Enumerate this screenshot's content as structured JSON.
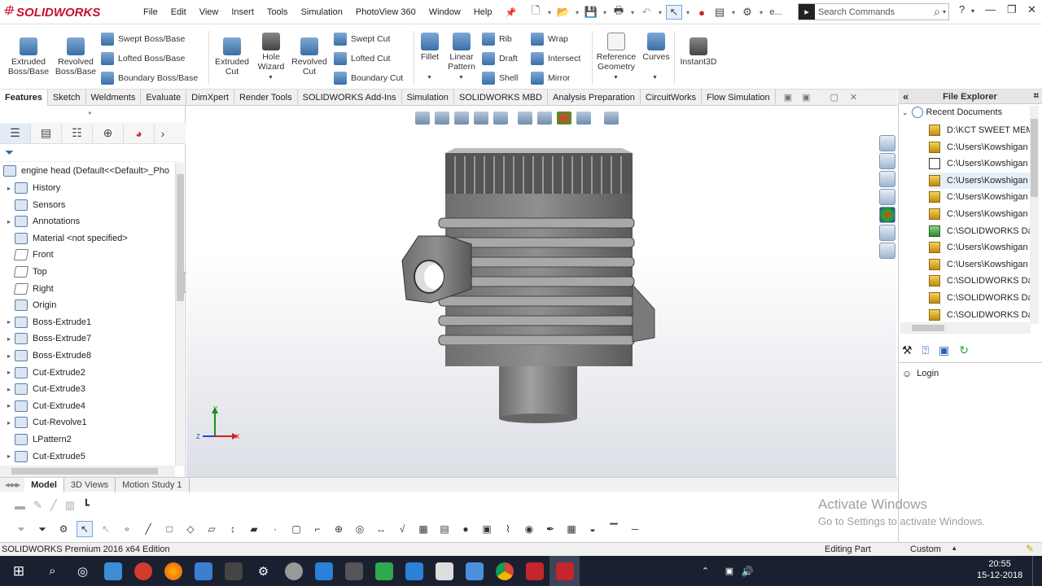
{
  "app": {
    "brand": "SOLIDWORKS",
    "menu": [
      "File",
      "Edit",
      "View",
      "Insert",
      "Tools",
      "Simulation",
      "PhotoView 360",
      "Window",
      "Help"
    ],
    "quick_access_truncated": "e...",
    "search_placeholder": "Search Commands",
    "help_glyph": "?"
  },
  "command_manager": {
    "big_tools": [
      {
        "label": "Extruded\nBoss/Base"
      },
      {
        "label": "Revolved\nBoss/Base"
      },
      {
        "label": "Extruded\nCut"
      },
      {
        "label": "Hole\nWizard"
      },
      {
        "label": "Revolved\nCut"
      },
      {
        "label": "Fillet"
      },
      {
        "label": "Linear\nPattern"
      },
      {
        "label": "Reference\nGeometry"
      },
      {
        "label": "Curves"
      },
      {
        "label": "Instant3D"
      }
    ],
    "small_tools": {
      "boss": [
        "Swept Boss/Base",
        "Lofted Boss/Base",
        "Boundary Boss/Base"
      ],
      "cut": [
        "Swept Cut",
        "Lofted Cut",
        "Boundary Cut"
      ],
      "features1": [
        "Rib",
        "Draft",
        "Shell"
      ],
      "features2": [
        "Wrap",
        "Intersect",
        "Mirror"
      ]
    }
  },
  "tabs": [
    "Features",
    "Sketch",
    "Weldments",
    "Evaluate",
    "DimXpert",
    "Render Tools",
    "SOLIDWORKS Add-Ins",
    "Simulation",
    "SOLIDWORKS MBD",
    "Analysis Preparation",
    "CircuitWorks",
    "Flow Simulation"
  ],
  "active_tab": "Features",
  "feature_tree": {
    "root": "engine head  (Default<<Default>_Pho",
    "items": [
      {
        "label": "History",
        "expandable": true
      },
      {
        "label": "Sensors",
        "expandable": false
      },
      {
        "label": "Annotations",
        "expandable": true
      },
      {
        "label": "Material <not specified>",
        "expandable": false
      },
      {
        "label": "Front",
        "expandable": false
      },
      {
        "label": "Top",
        "expandable": false
      },
      {
        "label": "Right",
        "expandable": false
      },
      {
        "label": "Origin",
        "expandable": false
      },
      {
        "label": "Boss-Extrude1",
        "expandable": true
      },
      {
        "label": "Boss-Extrude7",
        "expandable": true
      },
      {
        "label": "Boss-Extrude8",
        "expandable": true
      },
      {
        "label": "Cut-Extrude2",
        "expandable": true
      },
      {
        "label": "Cut-Extrude3",
        "expandable": true
      },
      {
        "label": "Cut-Extrude4",
        "expandable": true
      },
      {
        "label": "Cut-Revolve1",
        "expandable": true
      },
      {
        "label": "LPattern2",
        "expandable": false
      },
      {
        "label": "Cut-Extrude5",
        "expandable": true
      }
    ]
  },
  "bottom_tabs": [
    "Model",
    "3D Views",
    "Motion Study 1"
  ],
  "active_bottom_tab": "Model",
  "file_explorer": {
    "title": "File Explorer",
    "section": "Recent Documents",
    "docs": [
      {
        "label": "D:\\KCT SWEET MEM",
        "kind": "part"
      },
      {
        "label": "C:\\Users\\Kowshigan",
        "kind": "part"
      },
      {
        "label": "C:\\Users\\Kowshigan",
        "kind": "drawing"
      },
      {
        "label": "C:\\Users\\Kowshigan",
        "kind": "part"
      },
      {
        "label": "C:\\Users\\Kowshigan",
        "kind": "part"
      },
      {
        "label": "C:\\Users\\Kowshigan",
        "kind": "part"
      },
      {
        "label": "C:\\SOLIDWORKS Dat",
        "kind": "assembly"
      },
      {
        "label": "C:\\Users\\Kowshigan",
        "kind": "part"
      },
      {
        "label": "C:\\Users\\Kowshigan",
        "kind": "part"
      },
      {
        "label": "C:\\SOLIDWORKS Dat",
        "kind": "part"
      },
      {
        "label": "C:\\SOLIDWORKS Dat",
        "kind": "part"
      },
      {
        "label": "C:\\SOLIDWORKS Dat",
        "kind": "part"
      }
    ],
    "login_label": "Login"
  },
  "triad": {
    "x": "X",
    "y": "Y",
    "z": "Z"
  },
  "status": {
    "edition": "SOLIDWORKS Premium 2016 x64 Edition",
    "mode": "Editing Part",
    "units": "Custom"
  },
  "watermark": {
    "line1": "Activate Windows",
    "line2": "Go to Settings to activate Windows."
  },
  "taskbar": {
    "time": "20:55",
    "date": "15-12-2018"
  }
}
